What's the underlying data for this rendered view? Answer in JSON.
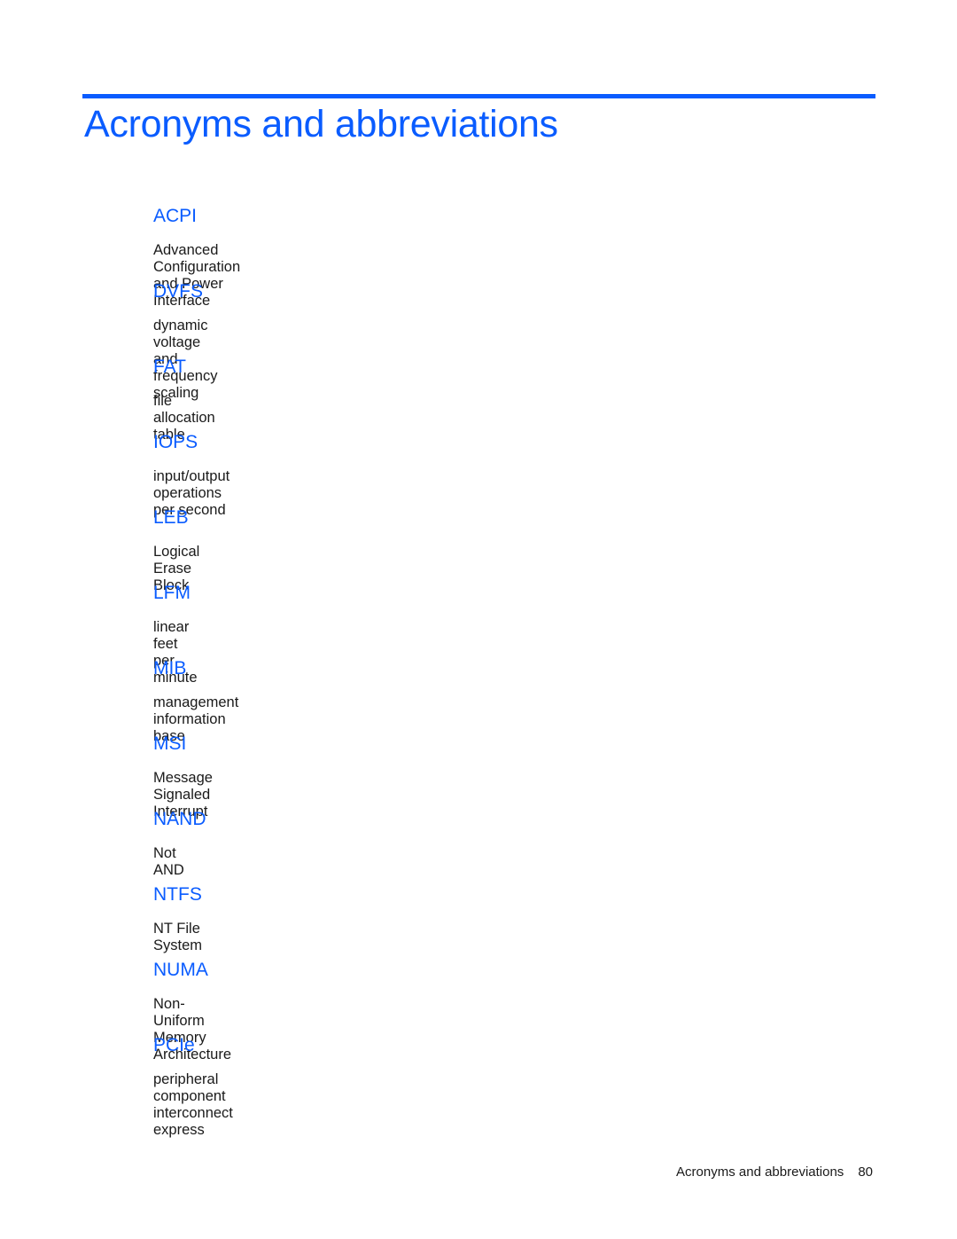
{
  "header": {
    "title": "Acronyms and abbreviations",
    "accent_color": "#0a5cff"
  },
  "entries": [
    {
      "term": "ACPI",
      "definition": "Advanced Configuration and Power Interface"
    },
    {
      "term": "DVFS",
      "definition": "dynamic voltage and frequency scaling"
    },
    {
      "term": "FAT",
      "definition": "file allocation table"
    },
    {
      "term": "IOPS",
      "definition": "input/output operations per second"
    },
    {
      "term": "LEB",
      "definition": "Logical Erase Block"
    },
    {
      "term": "LFM",
      "definition": "linear feet per minute"
    },
    {
      "term": "MIB",
      "definition": "management information base"
    },
    {
      "term": "MSI",
      "definition": "Message Signaled Interrupt"
    },
    {
      "term": "NAND",
      "definition": "Not AND"
    },
    {
      "term": "NTFS",
      "definition": "NT File System"
    },
    {
      "term": "NUMA",
      "definition": "Non-Uniform Memory Architecture"
    },
    {
      "term": "PCIe",
      "definition": "peripheral component interconnect express"
    }
  ],
  "footer": {
    "section": "Acronyms and abbreviations",
    "page_number": "80"
  }
}
